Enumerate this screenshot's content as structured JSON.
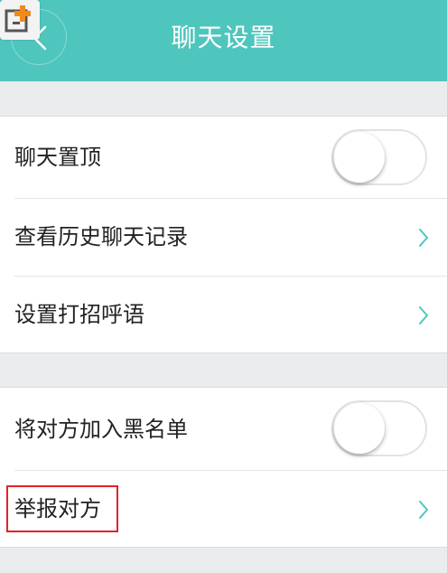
{
  "header": {
    "title": "聊天设置"
  },
  "settings": {
    "group1": [
      {
        "label": "聊天置顶",
        "control": "toggle",
        "on": false
      },
      {
        "label": "查看历史聊天记录",
        "control": "chevron"
      },
      {
        "label": "设置打招呼语",
        "control": "chevron"
      }
    ],
    "group2": [
      {
        "label": "将对方加入黑名单",
        "control": "toggle",
        "on": false
      },
      {
        "label": "举报对方",
        "control": "chevron",
        "highlighted": true
      }
    ]
  },
  "colors": {
    "header_bg": "#4fc6bd",
    "chevron": "#4fc6bd",
    "highlight_box": "#e3222b",
    "page_bg": "#eaeced"
  },
  "icons": {
    "back": "chevron-left-icon",
    "logo": "orange-plus-badge-icon",
    "row_arrow": "chevron-right-icon"
  }
}
